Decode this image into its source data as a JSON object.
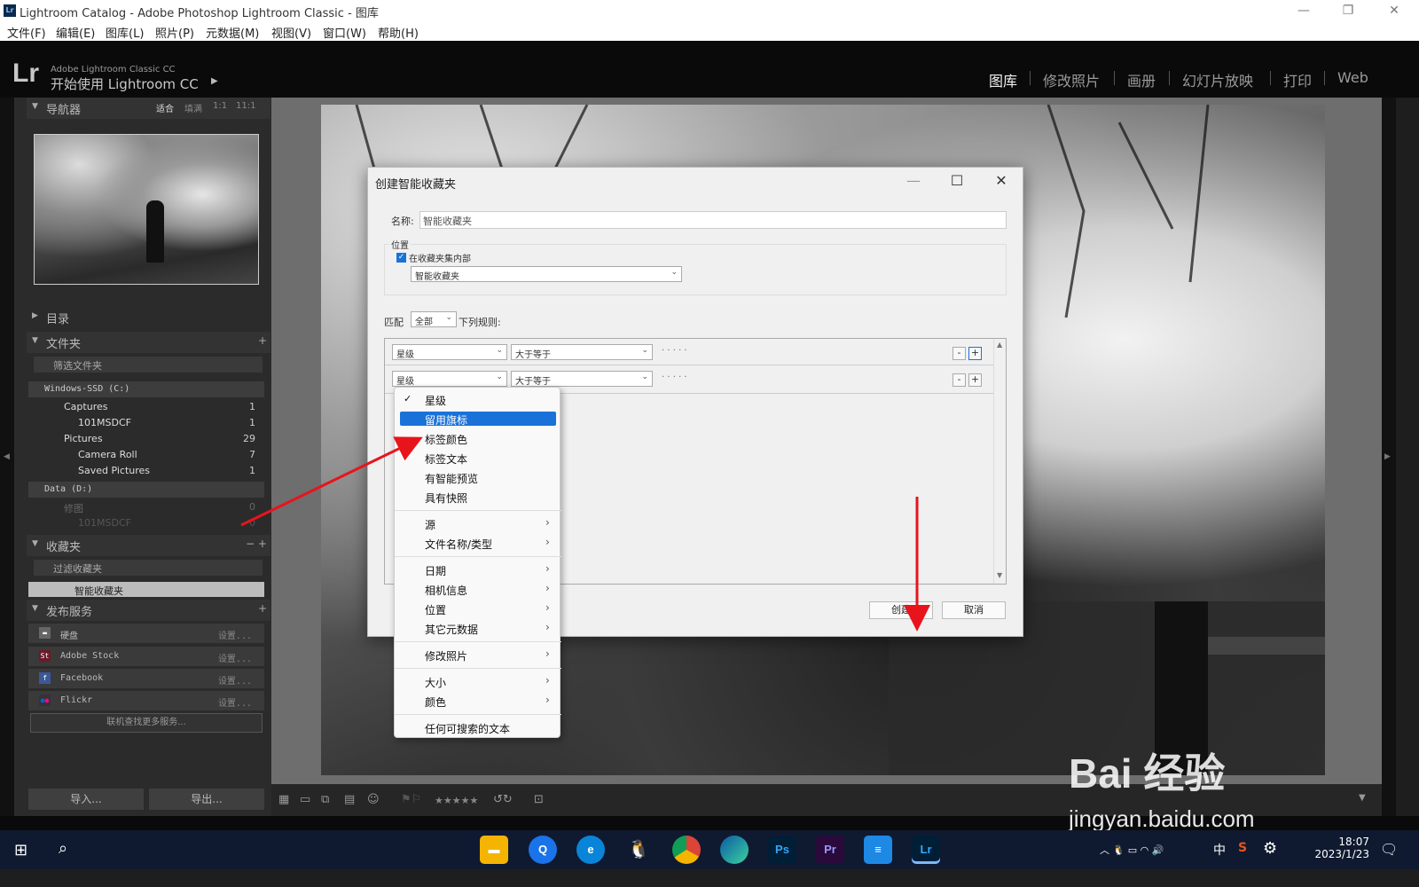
{
  "window": {
    "title": "Lightroom Catalog - Adobe Photoshop Lightroom Classic - 图库",
    "minimize": "—",
    "maximize": "❐",
    "close": "✕"
  },
  "menubar": [
    "文件(F)",
    "编辑(E)",
    "图库(L)",
    "照片(P)",
    "元数据(M)",
    "视图(V)",
    "窗口(W)",
    "帮助(H)"
  ],
  "header": {
    "logo": "Lr",
    "subtitle": "Adobe Lightroom Classic CC",
    "get_started": "开始使用 Lightroom CC",
    "modules": [
      "图库",
      "修改照片",
      "画册",
      "幻灯片放映",
      "打印",
      "Web"
    ],
    "active_module": "图库"
  },
  "navigator": {
    "title": "导航器",
    "zoom": [
      "适合",
      "填满",
      "1:1",
      "11:1"
    ]
  },
  "catalog": {
    "title": "目录"
  },
  "folders": {
    "title": "文件夹",
    "filter_placeholder": "筛选文件夹",
    "volume_c": "Windows-SSD (C:)",
    "tree": [
      {
        "name": "Captures",
        "count": "1"
      },
      {
        "name": "101MSDCF",
        "count": "1"
      },
      {
        "name": "Pictures",
        "count": "29"
      },
      {
        "name": "Camera Roll",
        "count": "7"
      },
      {
        "name": "Saved Pictures",
        "count": "1"
      }
    ],
    "volume_d": "Data (D:)",
    "tree_d": [
      {
        "name": "修图",
        "count": "0"
      },
      {
        "name": "101MSDCF",
        "count": "0"
      }
    ]
  },
  "collections": {
    "title": "收藏夹",
    "filter_placeholder": "过滤收藏夹",
    "items": [
      "智能收藏夹"
    ]
  },
  "publish": {
    "title": "发布服务",
    "services": [
      {
        "name": "硬盘",
        "setup": "设置..."
      },
      {
        "name": "Adobe Stock",
        "setup": "设置..."
      },
      {
        "name": "Facebook",
        "setup": "设置..."
      },
      {
        "name": "Flickr",
        "setup": "设置..."
      }
    ],
    "find_more": "联机查找更多服务..."
  },
  "bottom_buttons": {
    "import": "导入...",
    "export": "导出..."
  },
  "toolbar": {
    "stars": "★★★★★"
  },
  "dialog": {
    "title": "创建智能收藏夹",
    "name_label": "名称:",
    "name_value": "智能收藏夹",
    "location_label": "位置",
    "inside_set_label": "在收藏夹集内部",
    "inside_set_value": "智能收藏夹",
    "match_label": "匹配",
    "match_value": "全部",
    "rules_label": "下列规则:",
    "rules": [
      {
        "field": "星级",
        "op": "大于等于",
        "stars": "· · · · ·"
      },
      {
        "field": "星级",
        "op": "大于等于",
        "stars": "· · · · ·"
      }
    ],
    "create": "创建",
    "cancel": "取消"
  },
  "popup_menu": {
    "checked": "星级",
    "highlighted": "留用旗标",
    "items_group1": [
      "星级",
      "留用旗标",
      "标签颜色",
      "标签文本",
      "有智能预览",
      "具有快照"
    ],
    "items_group2": [
      "源",
      "文件名称/类型"
    ],
    "items_group3": [
      "日期",
      "相机信息",
      "位置",
      "其它元数据"
    ],
    "items_group4": [
      "修改照片"
    ],
    "items_group5": [
      "大小",
      "颜色"
    ],
    "items_group6": [
      "任何可搜索的文本"
    ]
  },
  "taskbar": {
    "time": "18:07",
    "date": "2023/1/23",
    "ime": "中",
    "apps": [
      "Ps",
      "Pr",
      "Lr"
    ]
  },
  "watermark": {
    "line1": "Bai 经验",
    "line2": "jingyan.baidu.com"
  },
  "colors": {
    "highlight": "#1a72d8",
    "arrow": "#e8141c",
    "lr_blue": "#31a8ff",
    "ps_blue": "#31a8ff",
    "pr_purple": "#9999ff"
  }
}
